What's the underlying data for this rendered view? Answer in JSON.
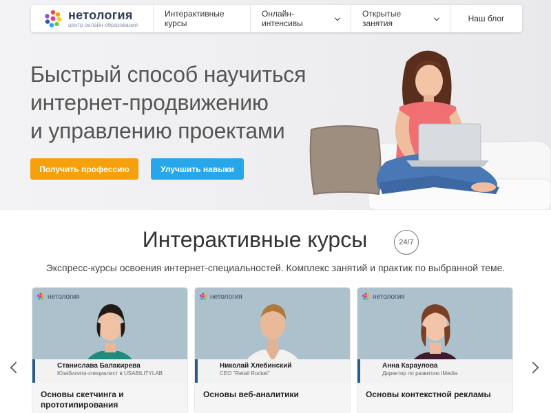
{
  "brand": {
    "name": "нетология",
    "tagline": "центр онлайн-образования",
    "colors": {
      "orange": "#f6a10b",
      "blue": "#27a6e9",
      "navy": "#2c5a8a"
    }
  },
  "nav": {
    "items": [
      {
        "label": "Интерактивные курсы",
        "has_dropdown": false
      },
      {
        "label": "Онлайн-интенсивы",
        "has_dropdown": true
      },
      {
        "label": "Открытые занятия",
        "has_dropdown": true
      },
      {
        "label": "Наш блог",
        "has_dropdown": false
      }
    ]
  },
  "hero": {
    "headline_lines": [
      "Быстрый способ научиться",
      "интернет-продвижению",
      "и управлению проектами"
    ],
    "primary_button": "Получить профессию",
    "secondary_button": "Улучшить навыки"
  },
  "section": {
    "title": "Интерактивные курсы",
    "badge": "24/7",
    "subtitle": "Экспресс-курсы освоения интернет-специальностей. Комплекс занятий и практик по выбранной теме."
  },
  "cards": [
    {
      "logo": "нетология",
      "speaker": "Станислава Балакирева",
      "role": "Юзабилити-специалист в USABILITYLAB",
      "course": "Основы скетчинга и прототипирования"
    },
    {
      "logo": "нетология",
      "speaker": "Николай Хлебинский",
      "role": "CEO \"Retail Rocket\"",
      "course": "Основы веб-аналитики"
    },
    {
      "logo": "нетология",
      "speaker": "Анна Караулова",
      "role": "Директор по развитию iMedia",
      "course": "Основы контекстной рекламы"
    }
  ],
  "icons": {
    "prev": "chevron-left-icon",
    "next": "chevron-right-icon",
    "dropdown": "chevron-down-icon"
  }
}
